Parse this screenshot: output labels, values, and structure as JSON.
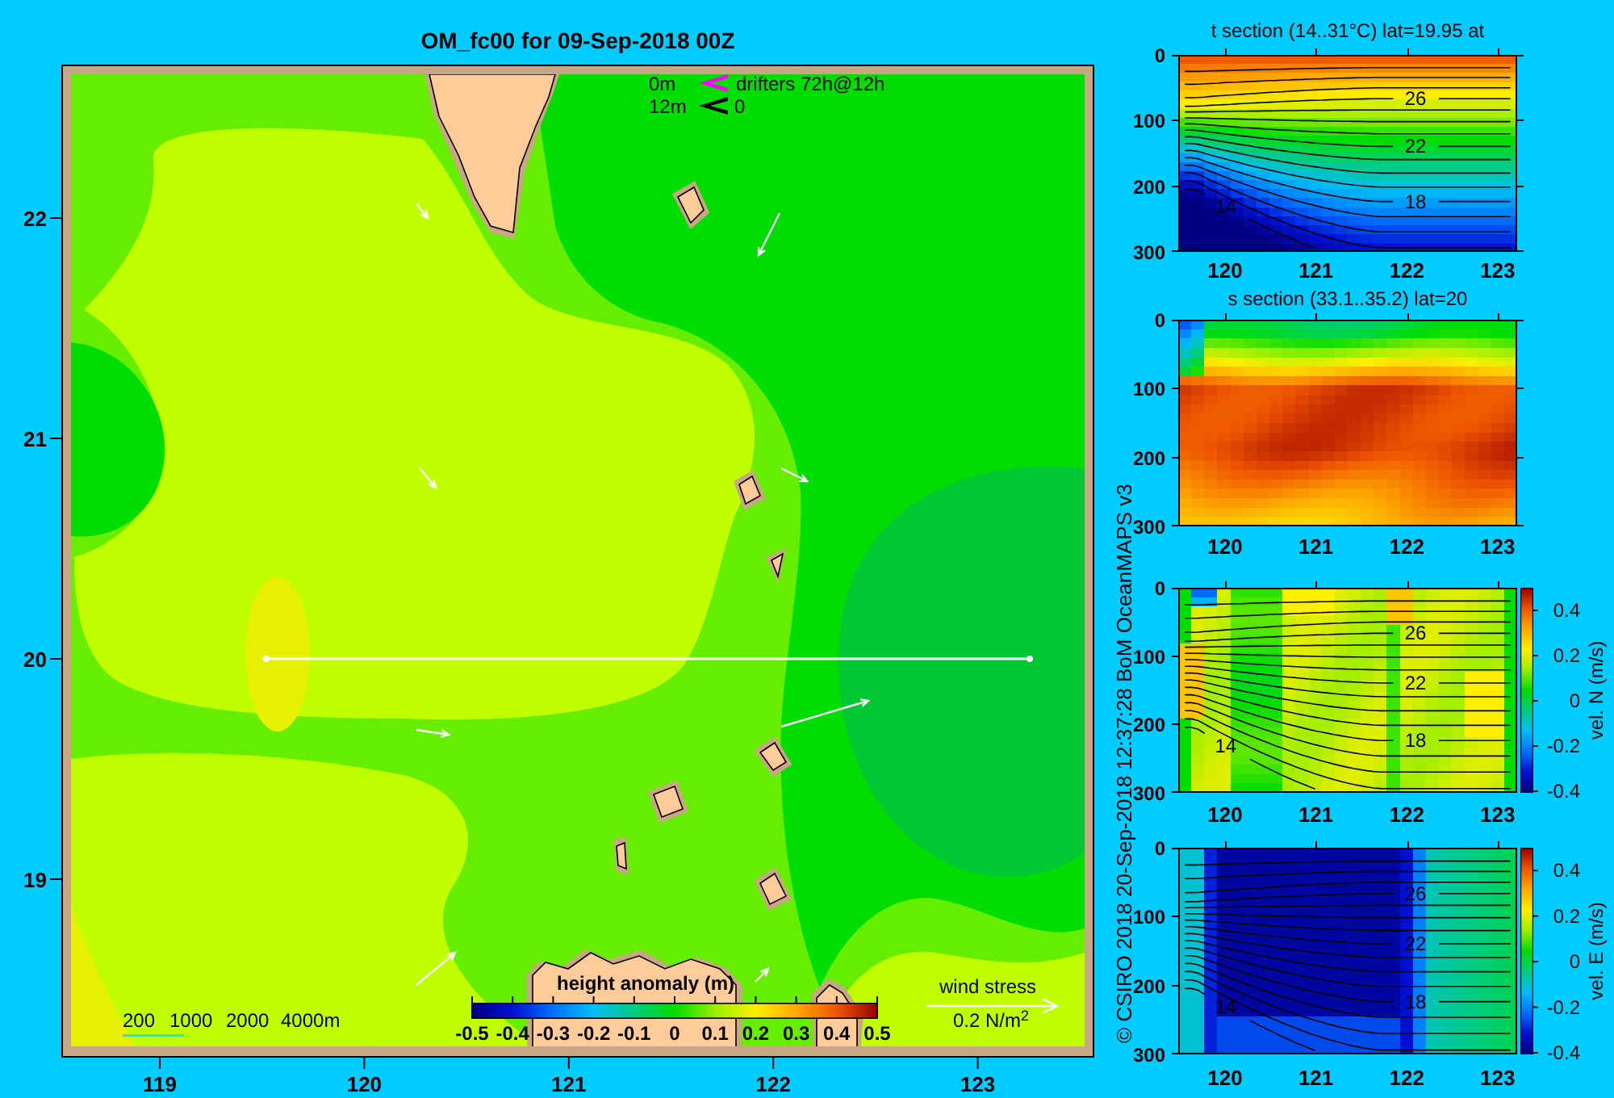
{
  "title": "OM_fc00 for 09-Sep-2018 00Z",
  "map": {
    "drifter_legend": {
      "label": "drifters 72h@12h",
      "items": [
        {
          "depth": "0m",
          "color": "#ff00ff"
        },
        {
          "depth": "12m",
          "color": "#000000",
          "marker": "0"
        }
      ]
    },
    "x_ticks": [
      "119",
      "120",
      "121",
      "122",
      "123"
    ],
    "y_ticks": [
      "22",
      "21",
      "20",
      "19"
    ],
    "depth_legend": [
      "200",
      "1000",
      "2000",
      "4000m"
    ],
    "colorbar": {
      "title": "height anomaly (m)",
      "ticks": [
        "-0.5",
        "-0.4",
        "-0.3",
        "-0.2",
        "-0.1",
        "0",
        "0.1",
        "0.2",
        "0.3",
        "0.4",
        "0.5"
      ]
    },
    "wind_stress": {
      "label": "wind stress",
      "scale": "0.2 N/m$^{2}$"
    }
  },
  "credit": "© CSIRO 2018 20-Sep-2018 12:37:28 BoM OceanMAPS v3",
  "sections": [
    {
      "kind": "temperature",
      "title": "t section (14..31°C) lat=19.95 at",
      "y_ticks": [
        "0",
        "100",
        "200",
        "300"
      ],
      "x_ticks": [
        "120",
        "121",
        "122",
        "123"
      ],
      "contour_labels": [
        "26",
        "22",
        "14",
        "18"
      ]
    },
    {
      "kind": "salinity",
      "title": "s section (33.1..35.2) lat=20",
      "y_ticks": [
        "0",
        "100",
        "200",
        "300"
      ],
      "x_ticks": [
        "120",
        "121",
        "122",
        "123"
      ]
    },
    {
      "kind": "velocity_north",
      "y_ticks": [
        "0",
        "100",
        "200",
        "300"
      ],
      "x_ticks": [
        "120",
        "121",
        "122",
        "123"
      ],
      "contour_labels": [
        "26",
        "22",
        "14",
        "18"
      ],
      "colorbar": {
        "label": "vel. N (m/s)",
        "ticks": [
          "0.4",
          "0.2",
          "0",
          "-0.2",
          "-0.4"
        ]
      }
    },
    {
      "kind": "velocity_east",
      "y_ticks": [
        "0",
        "100",
        "200",
        "300"
      ],
      "x_ticks": [
        "120",
        "121",
        "122",
        "123"
      ],
      "contour_labels": [
        "26",
        "22",
        "14",
        "18"
      ],
      "colorbar": {
        "label": "vel. E (m/s)",
        "ticks": [
          "0.4",
          "0.2",
          "0",
          "-0.2",
          "-0.4"
        ]
      }
    }
  ]
}
